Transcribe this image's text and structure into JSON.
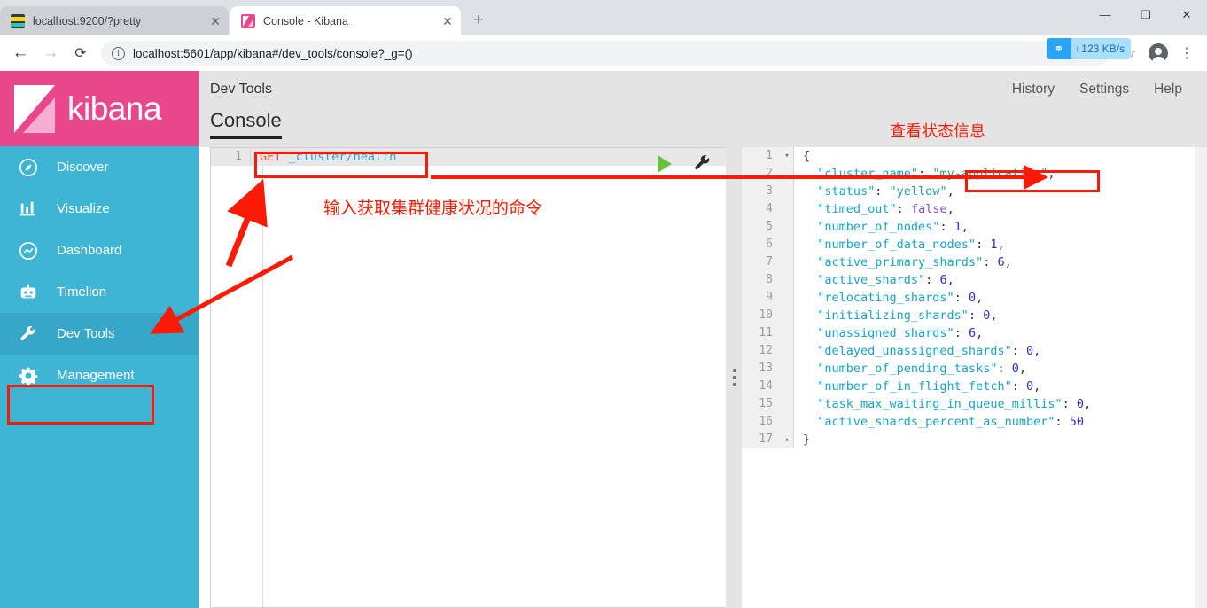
{
  "browser": {
    "tabs": [
      {
        "title": "localhost:9200/?pretty",
        "favicon": "elasticsearch-icon",
        "active": false,
        "close_label": "✕"
      },
      {
        "title": "Console - Kibana",
        "favicon": "kibana-icon",
        "active": true,
        "close_label": "✕"
      }
    ],
    "new_tab_label": "+",
    "window_controls": {
      "minimize": "—",
      "maximize": "❑",
      "close": "✕"
    },
    "nav": {
      "back": "←",
      "forward": "→",
      "reload": "⟳"
    },
    "url": "localhost:5601/app/kibana#/dev_tools/console?_g=()",
    "url_info_icon": "i",
    "bookmark_icon": "☆",
    "menu_icon": "⋮",
    "avatar_icon": "profile-icon",
    "download_badge": {
      "icon": "⚭",
      "arrow": "↓",
      "value": "123 KB/s"
    }
  },
  "sidebar": {
    "brand": "kibana",
    "items": [
      {
        "label": "Discover",
        "icon": "compass-icon",
        "active": false
      },
      {
        "label": "Visualize",
        "icon": "bar-chart-icon",
        "active": false
      },
      {
        "label": "Dashboard",
        "icon": "dashboard-icon",
        "active": false
      },
      {
        "label": "Timelion",
        "icon": "timelion-icon",
        "active": false
      },
      {
        "label": "Dev Tools",
        "icon": "wrench-icon",
        "active": true
      },
      {
        "label": "Management",
        "icon": "gear-icon",
        "active": false
      }
    ]
  },
  "header": {
    "app_title": "Dev Tools",
    "links": [
      "History",
      "Settings",
      "Help"
    ],
    "tab": "Console"
  },
  "request": {
    "line_number": "1",
    "method": "GET",
    "path": " _cluster/health",
    "run_button": "run-request-icon",
    "wrench_button": "request-options-icon"
  },
  "response": {
    "lines": [
      {
        "n": "1",
        "fold": "▾",
        "tokens": [
          {
            "t": "punc",
            "v": "{"
          }
        ]
      },
      {
        "n": "2",
        "fold": "",
        "tokens": [
          {
            "t": "key",
            "v": "  \"cluster_name\""
          },
          {
            "t": "punc",
            "v": ": "
          },
          {
            "t": "str",
            "v": "\"my-application\""
          },
          {
            "t": "punc",
            "v": ","
          }
        ]
      },
      {
        "n": "3",
        "fold": "",
        "tokens": [
          {
            "t": "key",
            "v": "  \"status\""
          },
          {
            "t": "punc",
            "v": ": "
          },
          {
            "t": "str",
            "v": "\"yellow\""
          },
          {
            "t": "punc",
            "v": ","
          }
        ]
      },
      {
        "n": "4",
        "fold": "",
        "tokens": [
          {
            "t": "key",
            "v": "  \"timed_out\""
          },
          {
            "t": "punc",
            "v": ": "
          },
          {
            "t": "bool",
            "v": "false"
          },
          {
            "t": "punc",
            "v": ","
          }
        ]
      },
      {
        "n": "5",
        "fold": "",
        "tokens": [
          {
            "t": "key",
            "v": "  \"number_of_nodes\""
          },
          {
            "t": "punc",
            "v": ": "
          },
          {
            "t": "num",
            "v": "1"
          },
          {
            "t": "punc",
            "v": ","
          }
        ]
      },
      {
        "n": "6",
        "fold": "",
        "tokens": [
          {
            "t": "key",
            "v": "  \"number_of_data_nodes\""
          },
          {
            "t": "punc",
            "v": ": "
          },
          {
            "t": "num",
            "v": "1"
          },
          {
            "t": "punc",
            "v": ","
          }
        ]
      },
      {
        "n": "7",
        "fold": "",
        "tokens": [
          {
            "t": "key",
            "v": "  \"active_primary_shards\""
          },
          {
            "t": "punc",
            "v": ": "
          },
          {
            "t": "num",
            "v": "6"
          },
          {
            "t": "punc",
            "v": ","
          }
        ]
      },
      {
        "n": "8",
        "fold": "",
        "tokens": [
          {
            "t": "key",
            "v": "  \"active_shards\""
          },
          {
            "t": "punc",
            "v": ": "
          },
          {
            "t": "num",
            "v": "6"
          },
          {
            "t": "punc",
            "v": ","
          }
        ]
      },
      {
        "n": "9",
        "fold": "",
        "tokens": [
          {
            "t": "key",
            "v": "  \"relocating_shards\""
          },
          {
            "t": "punc",
            "v": ": "
          },
          {
            "t": "num",
            "v": "0"
          },
          {
            "t": "punc",
            "v": ","
          }
        ]
      },
      {
        "n": "10",
        "fold": "",
        "tokens": [
          {
            "t": "key",
            "v": "  \"initializing_shards\""
          },
          {
            "t": "punc",
            "v": ": "
          },
          {
            "t": "num",
            "v": "0"
          },
          {
            "t": "punc",
            "v": ","
          }
        ]
      },
      {
        "n": "11",
        "fold": "",
        "tokens": [
          {
            "t": "key",
            "v": "  \"unassigned_shards\""
          },
          {
            "t": "punc",
            "v": ": "
          },
          {
            "t": "num",
            "v": "6"
          },
          {
            "t": "punc",
            "v": ","
          }
        ]
      },
      {
        "n": "12",
        "fold": "",
        "tokens": [
          {
            "t": "key",
            "v": "  \"delayed_unassigned_shards\""
          },
          {
            "t": "punc",
            "v": ": "
          },
          {
            "t": "num",
            "v": "0"
          },
          {
            "t": "punc",
            "v": ","
          }
        ]
      },
      {
        "n": "13",
        "fold": "",
        "tokens": [
          {
            "t": "key",
            "v": "  \"number_of_pending_tasks\""
          },
          {
            "t": "punc",
            "v": ": "
          },
          {
            "t": "num",
            "v": "0"
          },
          {
            "t": "punc",
            "v": ","
          }
        ]
      },
      {
        "n": "14",
        "fold": "",
        "tokens": [
          {
            "t": "key",
            "v": "  \"number_of_in_flight_fetch\""
          },
          {
            "t": "punc",
            "v": ": "
          },
          {
            "t": "num",
            "v": "0"
          },
          {
            "t": "punc",
            "v": ","
          }
        ]
      },
      {
        "n": "15",
        "fold": "",
        "tokens": [
          {
            "t": "key",
            "v": "  \"task_max_waiting_in_queue_millis\""
          },
          {
            "t": "punc",
            "v": ": "
          },
          {
            "t": "num",
            "v": "0"
          },
          {
            "t": "punc",
            "v": ","
          }
        ]
      },
      {
        "n": "16",
        "fold": "",
        "tokens": [
          {
            "t": "key",
            "v": "  \"active_shards_percent_as_number\""
          },
          {
            "t": "punc",
            "v": ": "
          },
          {
            "t": "num",
            "v": "50"
          }
        ]
      },
      {
        "n": "17",
        "fold": "▴",
        "tokens": [
          {
            "t": "punc",
            "v": "}"
          }
        ]
      }
    ]
  },
  "annotations": {
    "command_note": "输入获取集群健康状况的命令",
    "status_note": "查看状态信息",
    "color": "#fb1b05"
  }
}
